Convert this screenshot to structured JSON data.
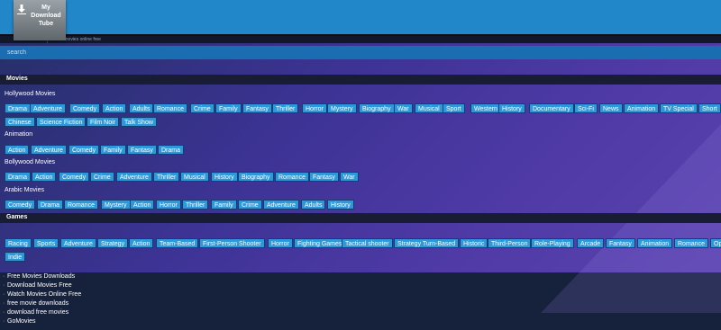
{
  "site": {
    "logo_line1": "My",
    "logo_line2": "Download",
    "logo_line3": "Tube",
    "subline": "Watch movies online free"
  },
  "search": {
    "placeholder": "search"
  },
  "colors": {
    "topbar": "#2287c9",
    "tag": "#2e99da",
    "section_bar": "#191d33"
  },
  "sections": {
    "movies": {
      "title": "Movies",
      "hollywood": {
        "title": "Hollywood Movies",
        "row1": [
          "Drama",
          "Adventure",
          "Comedy",
          "Action",
          "Adults",
          "Romance",
          "Crime",
          "Family",
          "Fantasy",
          "Thriller",
          "Horror",
          "Mystery",
          "Biography",
          "War",
          "Musical",
          "Sport",
          "Western",
          "History",
          "Documentary",
          "Sci-Fi",
          "News",
          "Animation",
          "TV Special",
          "Short"
        ],
        "row2": [
          "Chinese",
          "Science Fiction",
          "Film Noir",
          "Talk Show"
        ]
      },
      "animation": {
        "title": "Animation",
        "row1": [
          "Action",
          "Adventure",
          "Comedy",
          "Family",
          "Fantasy",
          "Drama"
        ]
      },
      "bollywood": {
        "title": "Bollywood Movies",
        "row1": [
          "Drama",
          "Action",
          "Comedy",
          "Crime",
          "Adventure",
          "Thriller",
          "Musical",
          "History",
          "Biography",
          "Romance",
          "Fantasy",
          "War"
        ]
      },
      "arabic": {
        "title": "Arabic Movies",
        "row1": [
          "Comedy",
          "Drama",
          "Romance",
          "Mystery",
          "Action",
          "Horror",
          "Thriller",
          "Family",
          "Crime",
          "Adventure",
          "Adults",
          "History"
        ]
      }
    },
    "games": {
      "title": "Games",
      "row1": [
        "Racing",
        "Sports",
        "Adventure",
        "Strategy",
        "Action",
        "Team-Based",
        "First-Person Shooter",
        "Horror",
        "Fighting Games",
        "Tactical shooter",
        "Strategy Turn-Based",
        "Historic",
        "Third-Person",
        "Role-Playing",
        "Arcade",
        "Fantasy",
        "Animation",
        "Romance",
        "Open"
      ],
      "row2": [
        "Indie"
      ]
    }
  },
  "footer_links": [
    "Free Movies Downloads",
    "Download Movies Free",
    "Watch Movies Online Free",
    "free movie downloads",
    "download free movies",
    "GoMovies"
  ]
}
